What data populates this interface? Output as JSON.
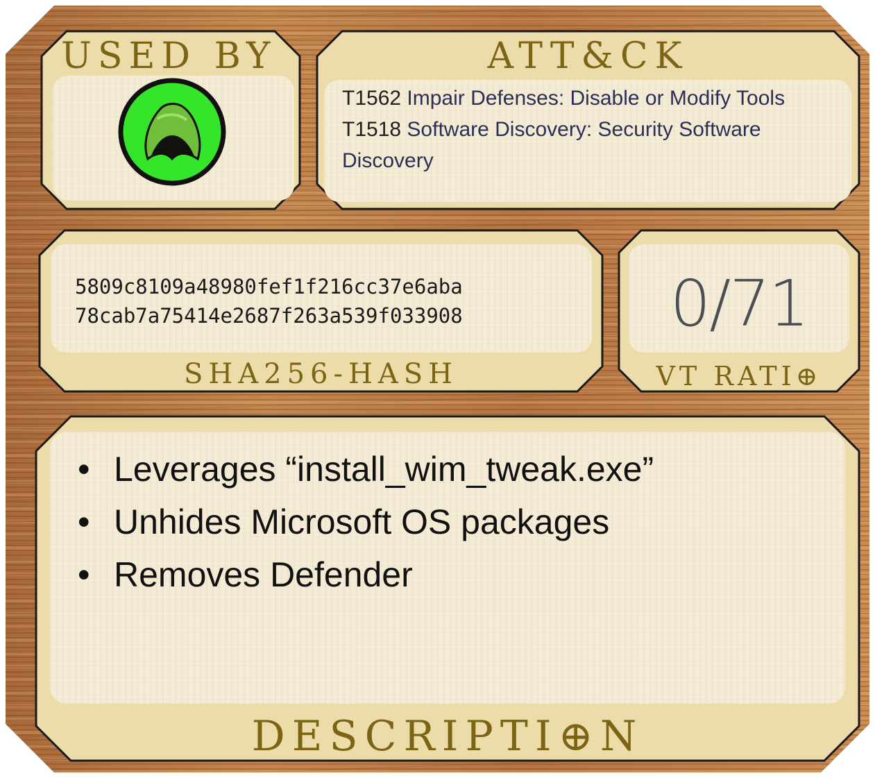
{
  "used_by": {
    "title": "USED BY",
    "logo_icon": "green-hood-icon"
  },
  "attck": {
    "title": "ATT&CK",
    "techniques": [
      {
        "id": "T1562",
        "text": " Impair Defenses: Disable or Modify Tools"
      },
      {
        "id": "T1518",
        "text": " Software Discovery:  Security Software Discovery"
      }
    ]
  },
  "hash": {
    "line1": "5809c8109a48980fef1f216cc37e6aba",
    "line2": "78cab7a75414e2687f263a539f033908",
    "title": "SHA256-HASH"
  },
  "vt": {
    "value": "0/71",
    "title": "VT RATI⊕"
  },
  "description": {
    "items": [
      "Leverages “install_wim_tweak.exe”",
      "Unhides Microsoft OS packages",
      "Removes Defender"
    ],
    "title": "DESCRIPTI⊕N"
  },
  "colors": {
    "wood": "#b87a45",
    "parchment": "#f4ecd6",
    "heading_gold": "#7d6415",
    "border": "#1a1a1a",
    "logo_green": "#35e52a"
  }
}
